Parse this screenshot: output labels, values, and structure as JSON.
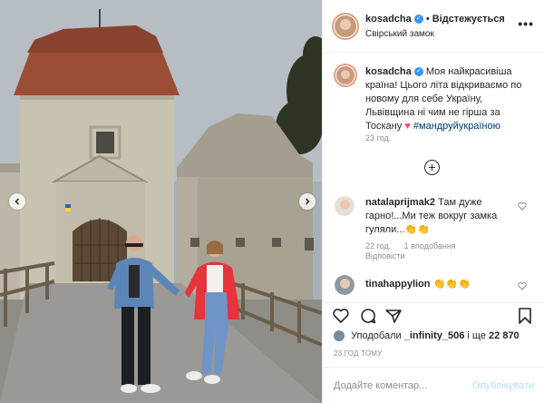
{
  "post": {
    "username": "kosadcha",
    "follow_label": "Відстежується",
    "location": "Свірський замок",
    "more_label": "•••",
    "caption": "Моя найкрасивіша країна! Цього літа відкриваємо по новому для себе Україну, Львівщина ні чим не гірша за Тоскану",
    "caption_heart": "♥",
    "hashtag": "#мандруйукраїною",
    "time_ago": "23 год.",
    "load_more": "+"
  },
  "comments": [
    {
      "username": "natalaprijmak2",
      "text": "Там дуже гарно!...Ми теж вокруг замка гуляли...👏👏",
      "time": "22 год.",
      "likes": "1 вподобання",
      "reply": "Відповісти"
    },
    {
      "username": "tinahappylion",
      "text": "👏👏👏"
    }
  ],
  "actions": {
    "likes_prefix": "Уподобали",
    "likes_user": "_infinity_506",
    "likes_mid": "і ще",
    "likes_count": "22 870",
    "post_time": "23 ГОД ТОМУ"
  },
  "comment_box": {
    "placeholder": "Додайте коментар...",
    "publish_label": "Опублікувати"
  },
  "icons": {
    "verified": "verified-badge-icon",
    "like": "heart-icon",
    "comment": "comment-icon",
    "share": "share-icon",
    "save": "bookmark-icon",
    "prev": "chevron-left-icon",
    "next": "chevron-right-icon"
  },
  "colors": {
    "link": "#00376b",
    "verified": "#3897f0",
    "publish_disabled": "#b2dffc",
    "jacket_red": "#e8303a",
    "denim": "#5b87c5"
  }
}
